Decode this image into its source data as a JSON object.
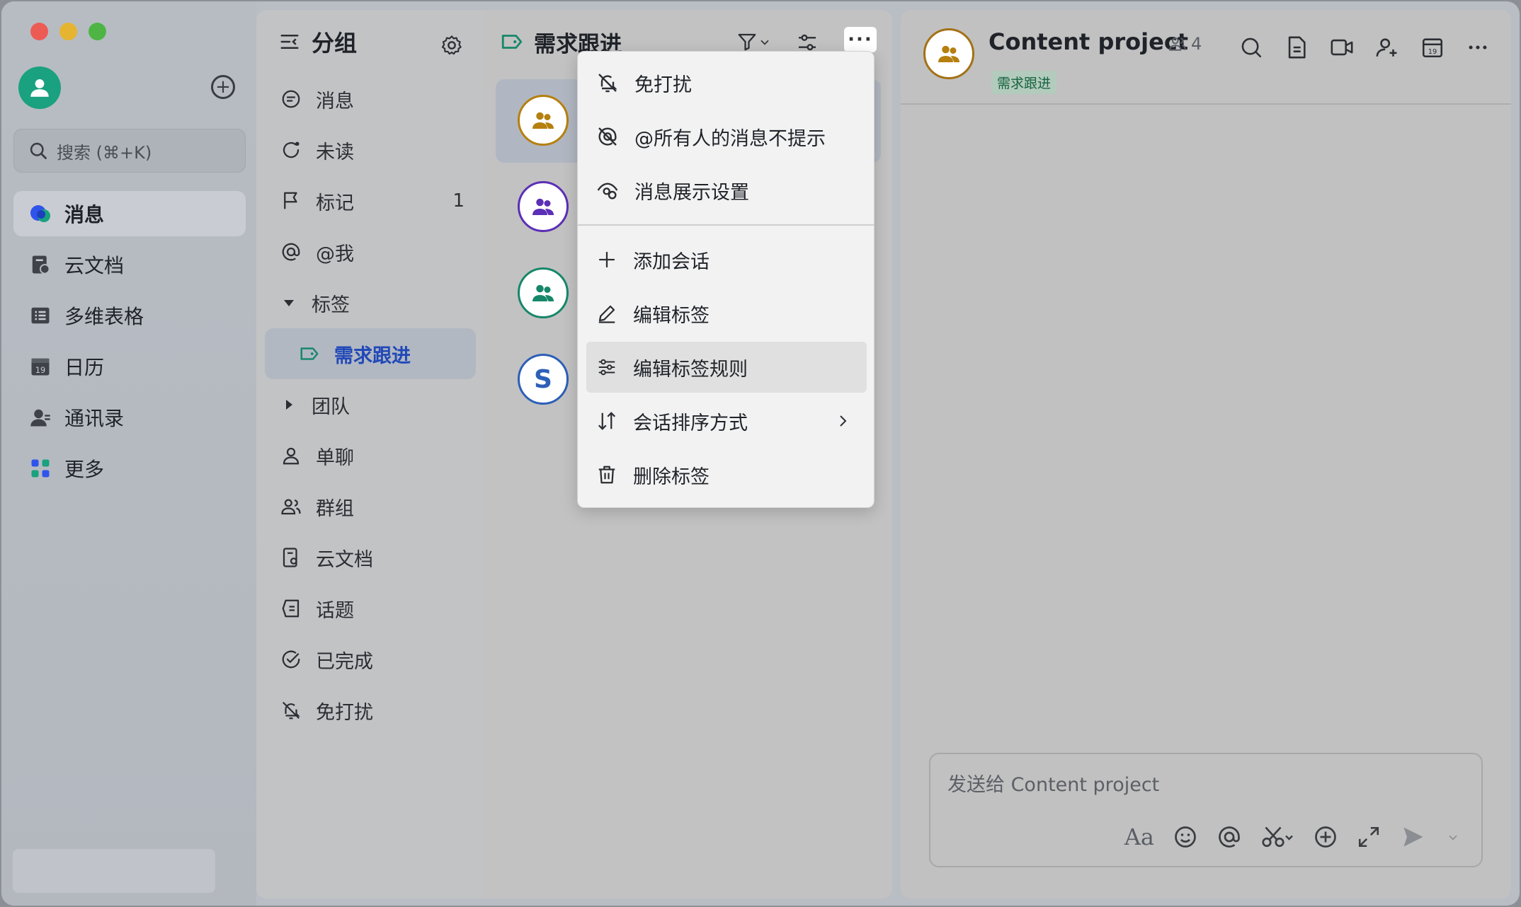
{
  "sidebar": {
    "search_placeholder": "搜索 (⌘+K)",
    "items": [
      {
        "label": "消息",
        "icon": "messages-icon"
      },
      {
        "label": "云文档",
        "icon": "docs-icon"
      },
      {
        "label": "多维表格",
        "icon": "base-icon"
      },
      {
        "label": "日历",
        "icon": "calendar-icon"
      },
      {
        "label": "通讯录",
        "icon": "contacts-icon"
      },
      {
        "label": "更多",
        "icon": "more-apps-icon"
      }
    ]
  },
  "groups": {
    "title": "分组",
    "items": [
      {
        "label": "消息"
      },
      {
        "label": "未读"
      },
      {
        "label": "标记",
        "count": "1"
      },
      {
        "label": "@我"
      },
      {
        "label": "标签"
      },
      {
        "label": "需求跟进"
      },
      {
        "label": "团队"
      },
      {
        "label": "单聊"
      },
      {
        "label": "群组"
      },
      {
        "label": "云文档"
      },
      {
        "label": "话题"
      },
      {
        "label": "已完成"
      },
      {
        "label": "免打扰"
      }
    ]
  },
  "chatlist": {
    "title": "需求跟进",
    "chats": [
      {
        "avatar_color": "#b5800f"
      },
      {
        "avatar_color": "#5b2fb6"
      },
      {
        "avatar_color": "#17876a"
      },
      {
        "avatar_color": "#2d5fb8",
        "initial": "S"
      }
    ]
  },
  "menu": {
    "items": [
      {
        "label": "免打扰",
        "icon": "bell-off-icon"
      },
      {
        "label": "@所有人的消息不提示",
        "icon": "at-mute-icon"
      },
      {
        "label": "消息展示设置",
        "icon": "display-settings-icon"
      },
      {
        "label": "添加会话",
        "icon": "plus-icon"
      },
      {
        "label": "编辑标签",
        "icon": "pencil-icon"
      },
      {
        "label": "编辑标签规则",
        "icon": "sliders-icon"
      },
      {
        "label": "会话排序方式",
        "icon": "sort-icon"
      },
      {
        "label": "删除标签",
        "icon": "trash-icon"
      }
    ]
  },
  "chat": {
    "title": "Content project",
    "member_count": "4",
    "tag": "需求跟进",
    "composer_placeholder": "发送给 Content project"
  },
  "colors": {
    "accent_blue": "#2149b8",
    "tag_green": "#16633f",
    "avatar_gold": "#b5800f"
  }
}
